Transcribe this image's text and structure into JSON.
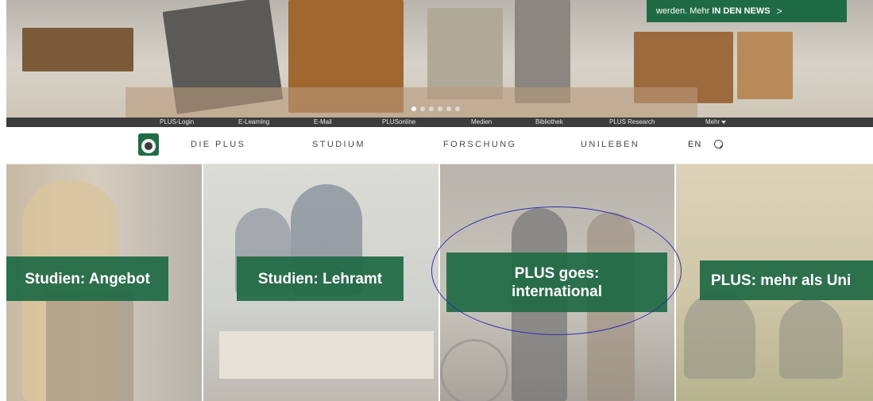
{
  "hero": {
    "news_text": "werden. Mehr",
    "news_link": "IN DEN NEWS",
    "news_chevron": ">",
    "slide_count": 6,
    "active_slide": 1
  },
  "utility_bar": {
    "items": [
      "PLUS-Login",
      "E-Learning",
      "E-Mail",
      "PLUSonline",
      "Medien",
      "Bibliothek",
      "PLUS Research",
      "Mehr"
    ]
  },
  "main_nav": {
    "items": [
      "DIE PLUS",
      "STUDIUM",
      "FORSCHUNG",
      "UNILEBEN"
    ],
    "language": "EN",
    "search_icon": "search-icon",
    "logo_icon": "university-seal-logo"
  },
  "tiles": [
    {
      "label_line1": "Studien: Angebot",
      "label_line2": ""
    },
    {
      "label_line1": "Studien: Lehramt",
      "label_line2": ""
    },
    {
      "label_line1": "PLUS goes:",
      "label_line2": "international"
    },
    {
      "label_line1": "PLUS: mehr als Uni",
      "label_line2": ""
    }
  ],
  "colors": {
    "brand_green": "#1f6b45",
    "utility_bar": "#3c3c3c",
    "annotation": "#2b2fb0"
  }
}
